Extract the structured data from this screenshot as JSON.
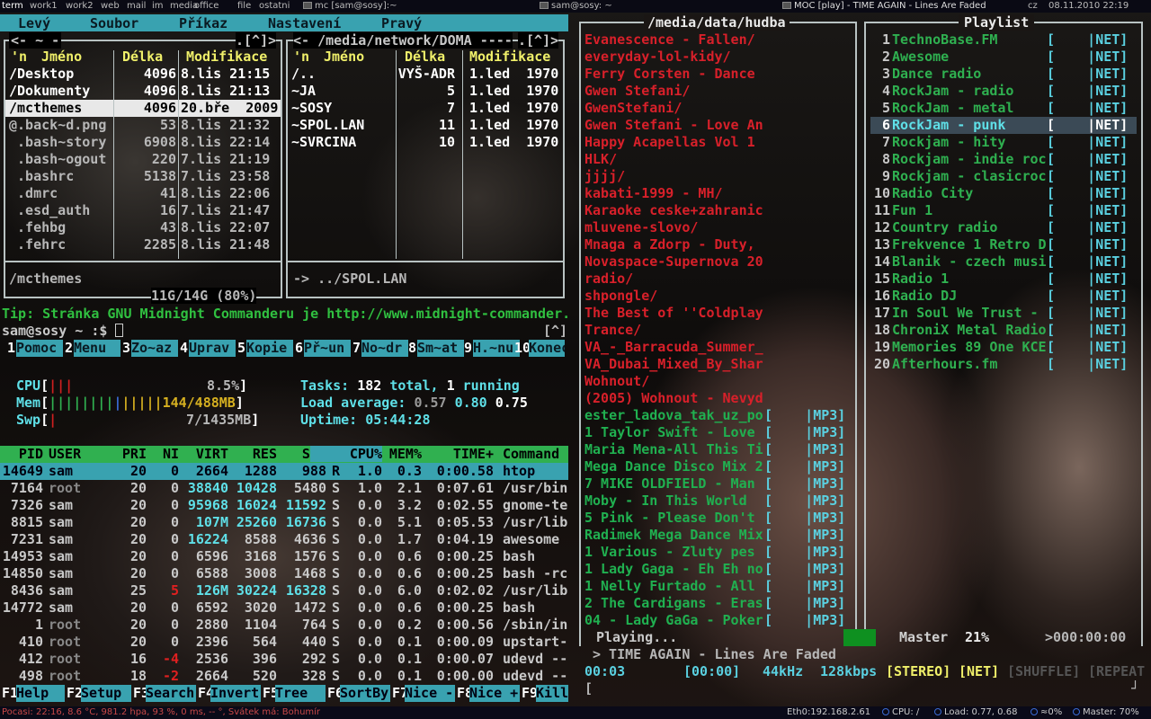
{
  "topbar": {
    "tags": [
      "term",
      "work1",
      "work2",
      "web",
      "mail",
      "im",
      "media",
      "office",
      "file",
      "ostatni"
    ],
    "windows": [
      "mc [sam@sosy]:~",
      "sam@sosy: ~",
      "MOC [play] - TIME AGAIN - Lines Are Faded"
    ],
    "layout": "cz",
    "clock": "08.11.2010 22:19"
  },
  "mc": {
    "menu": [
      "Levý",
      "Soubor",
      "Příkaz",
      "Nastavení",
      "Pravý"
    ],
    "left": {
      "path": "~",
      "corner": ".[^]>",
      "headers": {
        "n": "'n",
        "name": "Jméno",
        "size": "Délka",
        "mod": "Modifikace"
      },
      "rows": [
        {
          "name": "/Desktop",
          "size": "4096",
          "date": "8.lis 21:15"
        },
        {
          "name": "/Dokumenty",
          "size": "4096",
          "date": "8.lis 21:13"
        },
        {
          "name": "/mcthemes",
          "size": "4096",
          "date": "20.bře  2009"
        },
        {
          "name": "@.back~d.png",
          "size": "53",
          "date": "8.lis 21:32"
        },
        {
          "name": " .bash~story",
          "size": "6908",
          "date": "8.lis 22:14"
        },
        {
          "name": " .bash~ogout",
          "size": "220",
          "date": "7.lis 21:19"
        },
        {
          "name": " .bashrc",
          "size": "5138",
          "date": "7.lis 23:58"
        },
        {
          "name": " .dmrc",
          "size": "41",
          "date": "8.lis 22:06"
        },
        {
          "name": " .esd_auth",
          "size": "16",
          "date": "7.lis 21:47"
        },
        {
          "name": " .fehbg",
          "size": "43",
          "date": "8.lis 22:07"
        },
        {
          "name": " .fehrc",
          "size": "2285",
          "date": "8.lis 21:48"
        }
      ],
      "status": "/mcthemes",
      "disk": "11G/14G (80%)"
    },
    "right": {
      "path": "/media/network/DOMA",
      "corner": ".[^]>",
      "headers": {
        "n": "'n",
        "name": "Jméno",
        "size": "Délka",
        "mod": "Modifikace"
      },
      "rows": [
        {
          "name": "/..",
          "size": "VYŠ-ADR",
          "date": "1.led  1970"
        },
        {
          "name": "~JA",
          "size": "5",
          "date": "1.led  1970"
        },
        {
          "name": "~SOSY",
          "size": "7",
          "date": "1.led  1970"
        },
        {
          "name": "~SPOL.LAN",
          "size": "11",
          "date": "1.led  1970"
        },
        {
          "name": "~SVRCINA",
          "size": "10",
          "date": "1.led  1970"
        }
      ],
      "status": "-> ../SPOL.LAN"
    },
    "tip": "Tip: Stránka GNU Midnight Commanderu je http://www.midnight-commander.",
    "prompt": "sam@sosy ~ :$",
    "prompt_corner": "[^]",
    "fkeys": [
      {
        "n": "1",
        "label": "Pomoc"
      },
      {
        "n": "2",
        "label": "Menu"
      },
      {
        "n": "3",
        "label": "Zo~az"
      },
      {
        "n": "4",
        "label": "Uprav"
      },
      {
        "n": "5",
        "label": "Kopie"
      },
      {
        "n": "6",
        "label": "Př~un"
      },
      {
        "n": "7",
        "label": "No~dr"
      },
      {
        "n": "8",
        "label": "Sm~at"
      },
      {
        "n": "9",
        "label": "H.~nu"
      },
      {
        "n": "10",
        "label": "Konec"
      }
    ]
  },
  "htop": {
    "cpu_label": "CPU",
    "cpu_bars": "|||",
    "cpu_pct": "8.5%",
    "mem_label": "Mem",
    "mem_bars": "||||||||||||||",
    "mem_val": "144/488MB",
    "swp_label": "Swp",
    "swp_bars": "|",
    "swp_val": "7/1435MB",
    "tasks_label": "Tasks:",
    "tasks_total": "182",
    "tasks_total_word": "total,",
    "tasks_running": "1",
    "tasks_running_word": "running",
    "load_label": "Load average:",
    "load1": "0.57",
    "load5": "0.80",
    "load15": "0.75",
    "uptime_label": "Uptime:",
    "uptime": "05:44:28",
    "columns": [
      "PID",
      "USER",
      "PRI",
      "NI",
      "VIRT",
      "RES",
      "SHR",
      "S",
      "CPU%",
      "MEM%",
      "TIME+",
      "Command"
    ],
    "processes": [
      {
        "pid": "14649",
        "user": "sam",
        "pri": "20",
        "ni": "0",
        "virt": "2664",
        "res": "1288",
        "shr": "988",
        "s": "R",
        "cpu": "1.0",
        "mem": "0.3",
        "time": "0:00.58",
        "cmd": "htop"
      },
      {
        "pid": "7164",
        "user": "root",
        "pri": "20",
        "ni": "0",
        "virt": "38840",
        "res": "10428",
        "shr": "5480",
        "s": "S",
        "cpu": "1.0",
        "mem": "2.1",
        "time": "0:07.61",
        "cmd": "/usr/bin"
      },
      {
        "pid": "7326",
        "user": "sam",
        "pri": "20",
        "ni": "0",
        "virt": "95968",
        "res": "16024",
        "shr": "11592",
        "s": "S",
        "cpu": "0.0",
        "mem": "3.2",
        "time": "0:02.55",
        "cmd": "gnome-te"
      },
      {
        "pid": "8815",
        "user": "sam",
        "pri": "20",
        "ni": "0",
        "virt": "107M",
        "res": "25260",
        "shr": "16736",
        "s": "S",
        "cpu": "0.0",
        "mem": "5.1",
        "time": "0:05.53",
        "cmd": "/usr/lib"
      },
      {
        "pid": "7231",
        "user": "sam",
        "pri": "20",
        "ni": "0",
        "virt": "16224",
        "res": "8588",
        "shr": "4636",
        "s": "S",
        "cpu": "0.0",
        "mem": "1.7",
        "time": "0:04.19",
        "cmd": "awesome"
      },
      {
        "pid": "14953",
        "user": "sam",
        "pri": "20",
        "ni": "0",
        "virt": "6596",
        "res": "3168",
        "shr": "1576",
        "s": "S",
        "cpu": "0.0",
        "mem": "0.6",
        "time": "0:00.25",
        "cmd": "bash"
      },
      {
        "pid": "14850",
        "user": "sam",
        "pri": "20",
        "ni": "0",
        "virt": "6588",
        "res": "3008",
        "shr": "1468",
        "s": "S",
        "cpu": "0.0",
        "mem": "0.6",
        "time": "0:00.25",
        "cmd": "bash -rc"
      },
      {
        "pid": "8436",
        "user": "sam",
        "pri": "25",
        "ni": "5",
        "virt": "126M",
        "res": "30224",
        "shr": "16328",
        "s": "S",
        "cpu": "0.0",
        "mem": "6.0",
        "time": "0:02.02",
        "cmd": "/usr/lib"
      },
      {
        "pid": "14772",
        "user": "sam",
        "pri": "20",
        "ni": "0",
        "virt": "6592",
        "res": "3020",
        "shr": "1472",
        "s": "S",
        "cpu": "0.0",
        "mem": "0.6",
        "time": "0:00.25",
        "cmd": "bash"
      },
      {
        "pid": "1",
        "user": "root",
        "pri": "20",
        "ni": "0",
        "virt": "2880",
        "res": "1104",
        "shr": "764",
        "s": "S",
        "cpu": "0.0",
        "mem": "0.2",
        "time": "0:00.56",
        "cmd": "/sbin/in"
      },
      {
        "pid": "410",
        "user": "root",
        "pri": "20",
        "ni": "0",
        "virt": "2396",
        "res": "564",
        "shr": "440",
        "s": "S",
        "cpu": "0.0",
        "mem": "0.1",
        "time": "0:00.09",
        "cmd": "upstart-"
      },
      {
        "pid": "412",
        "user": "root",
        "pri": "16",
        "ni": "-4",
        "virt": "2536",
        "res": "396",
        "shr": "292",
        "s": "S",
        "cpu": "0.0",
        "mem": "0.1",
        "time": "0:00.07",
        "cmd": "udevd --"
      },
      {
        "pid": "498",
        "user": "root",
        "pri": "18",
        "ni": "-2",
        "virt": "2664",
        "res": "520",
        "shr": "328",
        "s": "S",
        "cpu": "0.0",
        "mem": "0.1",
        "time": "0:00.00",
        "cmd": "udevd --"
      }
    ],
    "fkeys": [
      {
        "n": "F1",
        "label": "Help"
      },
      {
        "n": "F2",
        "label": "Setup"
      },
      {
        "n": "F3",
        "label": "Search"
      },
      {
        "n": "F4",
        "label": "Invert"
      },
      {
        "n": "F5",
        "label": "Tree"
      },
      {
        "n": "F6",
        "label": "SortBy"
      },
      {
        "n": "F7",
        "label": "Nice -"
      },
      {
        "n": "F8",
        "label": "Nice +"
      },
      {
        "n": "F9",
        "label": "Kill"
      }
    ]
  },
  "moc": {
    "dir_title": "/media/data/hudba",
    "playlist_title": "Playlist",
    "dirs": [
      "Evanescence - Fallen/",
      "everyday-lol-kidy/",
      "Ferry Corsten - Dance",
      "Gwen Stefani/",
      "GwenStefani/",
      "Gwen Stefani - Love An",
      "Happy Acapellas Vol 1",
      "HLK/",
      "jjjj/",
      "kabati-1999 - MH/",
      "Karaoke ceske+zahranic",
      "mluvene-slovo/",
      "Mnaga a Zdorp - Duty,",
      "Novaspace-Supernova 20",
      "radio/",
      "shpongle/",
      "The Best of ''Coldplay",
      "Trance/",
      "VA_-_Barracuda_Summer_",
      "VA_Dubai_Mixed_By_Shar",
      "Wohnout/",
      "(2005) Wohnout - Nevyd"
    ],
    "files": [
      "ester_ladova_tak_uz_po",
      "1 Taylor Swift - Love ",
      "Maria Mena-All This Ti",
      "Mega Dance Disco Mix 2",
      "7 MIKE OLDFIELD - Man ",
      "Moby - In This World  ",
      "5 Pink - Please Don't ",
      "Radimek Mega Dance Mix",
      "1 Various - Zluty pes ",
      "1 Lady Gaga - Eh Eh no",
      "1 Nelly Furtado - All ",
      "2 The Cardigans - Eras",
      "04 - Lady GaGa - Poker"
    ],
    "file_tag": "MP3",
    "playlist": [
      "TechnoBase.FM",
      "Awesome",
      "Dance radio",
      "RockJam - radio",
      "RockJam - metal",
      "RockJam - punk",
      "Rockjam - hity",
      "Rockjam - indie roc",
      "Rockjam - clasicroc",
      "Radio City",
      "Fun 1",
      "Country radio",
      "Frekvence 1 Retro D",
      "Blanik - czech musi",
      "Radio 1",
      "Radio DJ",
      "In Soul We Trust -",
      "ChroniX Metal Radio",
      "Memories 89 One KCE",
      "Afterhours.fm"
    ],
    "playlist_tag": "NET",
    "selected_index": 6,
    "state": "Playing...",
    "volume_label": "Master",
    "volume": "21%",
    "time_right": ">000:00:00",
    "title": "> TIME AGAIN - Lines Are Faded",
    "elapsed": "00:03",
    "total": "[00:00]",
    "rate": "44kHz",
    "bitrate": "128kbps",
    "stereo": "[STEREO]",
    "net": "[NET]",
    "shuffle": "[SHUFFLE]",
    "repeat": "[REPEAT"
  },
  "status": {
    "weather": "Pocasi: 22:16, 8.6 °C, 981.2 hpa, 93 %, 0 ms, -- °,  Svátek má: Bohumír",
    "net": "Eth0:192.168.2.61",
    "cpu": "CPU: /",
    "load": "Load: 0.77, 0.68",
    "cpu2": "≈0%",
    "master": "Master: 70%"
  }
}
